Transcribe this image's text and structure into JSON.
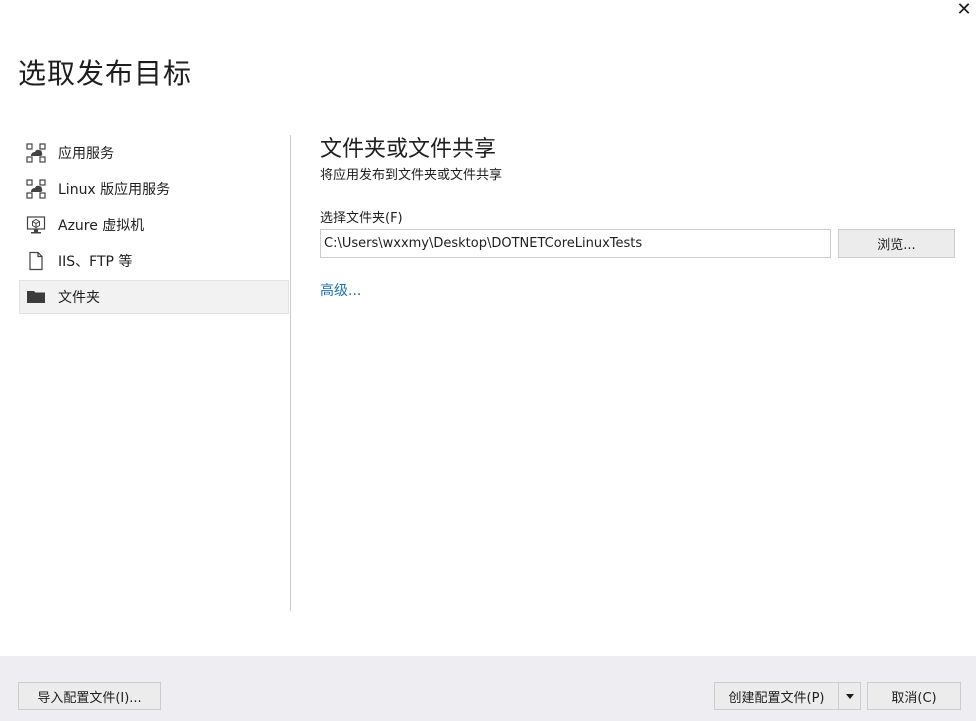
{
  "dialog": {
    "close_glyph": "✕",
    "title": "选取发布目标"
  },
  "sidebar": {
    "items": [
      {
        "label": "应用服务",
        "icon": "app-service-icon"
      },
      {
        "label": "Linux 版应用服务",
        "icon": "linux-app-service-icon"
      },
      {
        "label": "Azure 虚拟机",
        "icon": "virtual-machine-icon"
      },
      {
        "label": "IIS、FTP 等",
        "icon": "document-icon"
      },
      {
        "label": "文件夹",
        "icon": "folder-icon",
        "selected": true
      }
    ]
  },
  "content": {
    "title": "文件夹或文件共享",
    "subtitle": "将应用发布到文件夹或文件共享",
    "folder_label": "选择文件夹(F)",
    "folder_value": "C:\\Users\\wxxmy\\Desktop\\DOTNETCoreLinuxTests",
    "browse_label": "浏览...",
    "advanced_label": "高级..."
  },
  "footer": {
    "import_label": "导入配置文件(I)...",
    "create_label": "创建配置文件(P)",
    "cancel_label": "取消(C)"
  },
  "colors": {
    "link": "#1a73b5",
    "footer_bg": "#eeeef2",
    "selected_bg": "#f2f2f2"
  }
}
